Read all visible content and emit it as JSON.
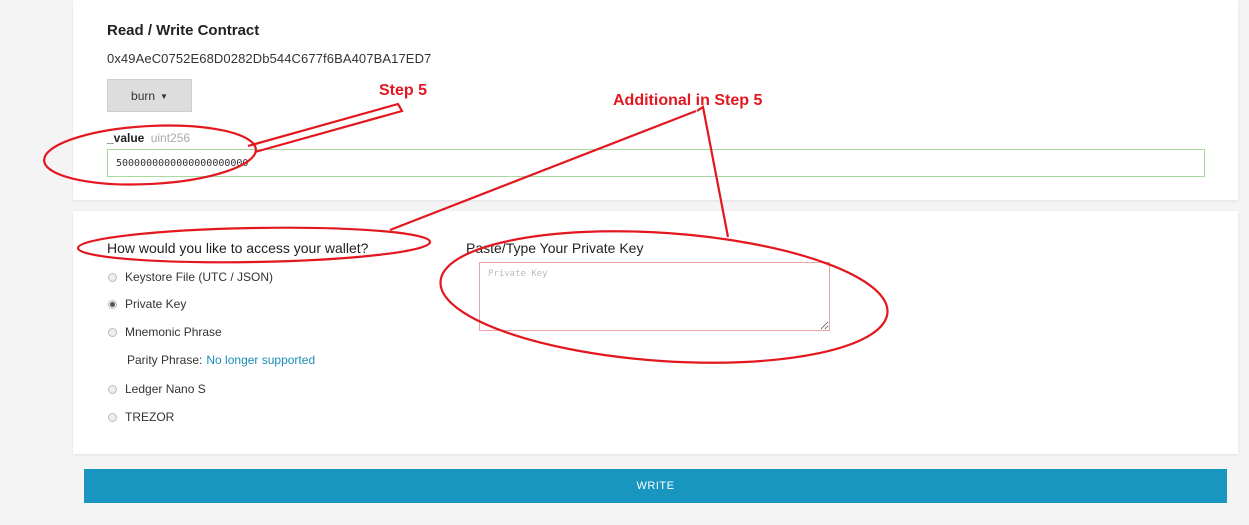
{
  "contract": {
    "title": "Read / Write Contract",
    "address": "0x49AeC0752E68D0282Db544C677f6BA407BA17ED7",
    "function_selected": "burn",
    "param_name": "_value",
    "param_type": "uint256",
    "param_value": "5000000000000000000000"
  },
  "wallet": {
    "title": "How would you like to access your wallet?",
    "options": [
      {
        "label": "Keystore File (UTC / JSON)",
        "checked": false
      },
      {
        "label": "Private Key",
        "checked": true
      },
      {
        "label": "Mnemonic Phrase",
        "checked": false
      },
      {
        "label": "Ledger Nano S",
        "checked": false
      },
      {
        "label": "TREZOR",
        "checked": false
      }
    ],
    "parity_label": "Parity Phrase:",
    "parity_link": "No longer supported"
  },
  "private_key": {
    "title": "Paste/Type Your Private Key",
    "placeholder": "Private Key",
    "value": ""
  },
  "actions": {
    "write_label": "WRITE"
  },
  "annotations": {
    "step5": "Step 5",
    "additional": "Additional in Step 5",
    "color": "#e3171f"
  }
}
